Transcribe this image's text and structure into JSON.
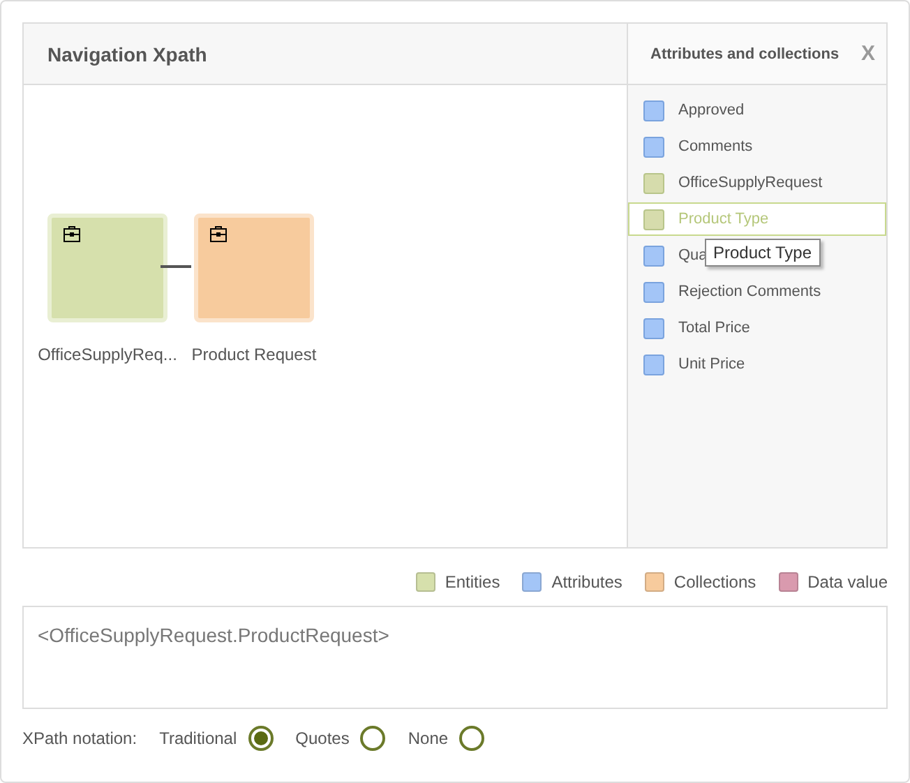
{
  "title": "Navigation Xpath",
  "nodes": [
    {
      "label": "OfficeSupplyReq...",
      "kind": "entity"
    },
    {
      "label": "Product Request",
      "kind": "collection"
    }
  ],
  "side_panel": {
    "title": "Attributes and collections",
    "close": "X",
    "items": [
      {
        "label": "Approved",
        "kind": "attribute",
        "selected": false
      },
      {
        "label": "Comments",
        "kind": "attribute",
        "selected": false
      },
      {
        "label": "OfficeSupplyRequest",
        "kind": "entity",
        "selected": false
      },
      {
        "label": "Product Type",
        "kind": "entity",
        "selected": true
      },
      {
        "label": "Qua",
        "kind": "attribute",
        "selected": false
      },
      {
        "label": "Rejection Comments",
        "kind": "attribute",
        "selected": false
      },
      {
        "label": "Total Price",
        "kind": "attribute",
        "selected": false
      },
      {
        "label": "Unit Price",
        "kind": "attribute",
        "selected": false
      }
    ],
    "tooltip": "Product Type"
  },
  "legend": [
    {
      "label": "Entities",
      "color": "#d6e0ac"
    },
    {
      "label": "Attributes",
      "color": "#a3c5f7"
    },
    {
      "label": "Collections",
      "color": "#f7cb9d"
    },
    {
      "label": "Data value",
      "color": "#d99aae"
    }
  ],
  "expression": "<OfficeSupplyRequest.ProductRequest>",
  "notation": {
    "label": "XPath notation:",
    "options": [
      {
        "label": "Traditional",
        "selected": true
      },
      {
        "label": "Quotes",
        "selected": false
      },
      {
        "label": "None",
        "selected": false
      }
    ]
  }
}
